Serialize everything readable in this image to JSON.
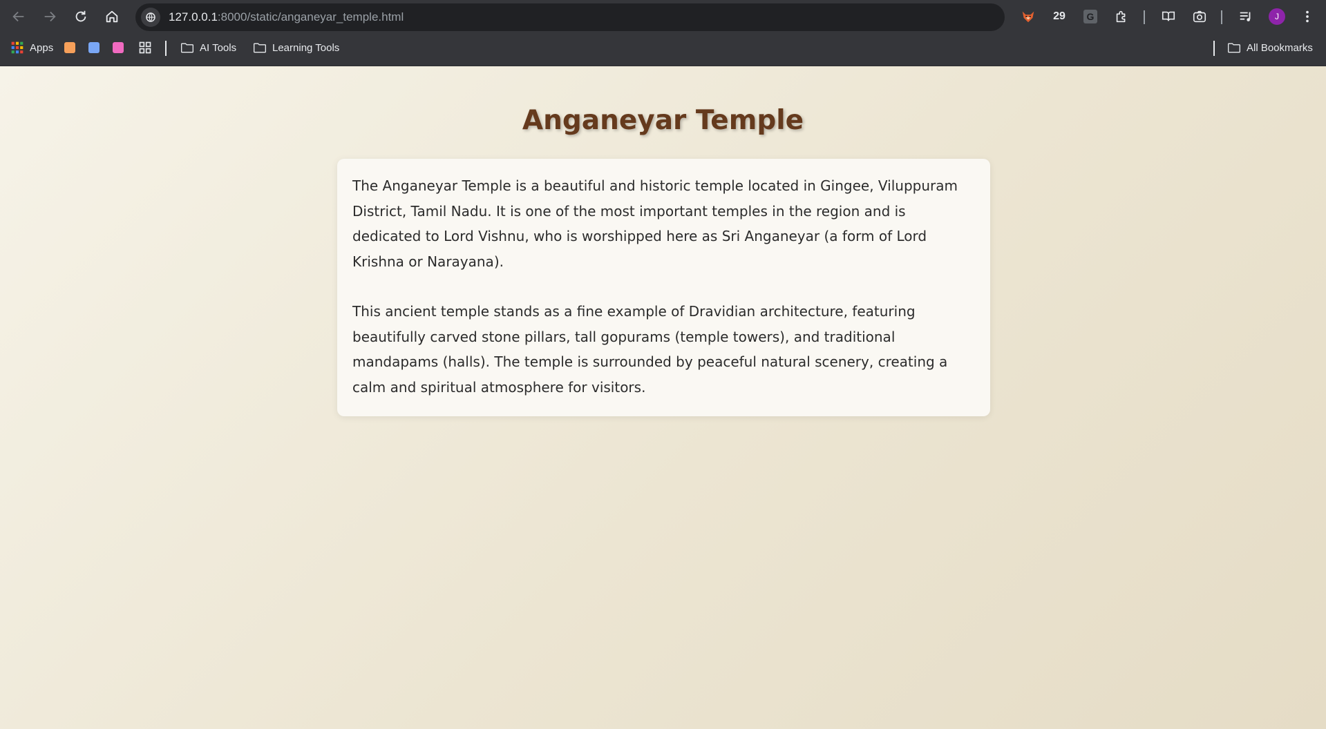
{
  "browser": {
    "url_host": "127.0.0.1",
    "url_path": ":8000/static/anganeyar_temple.html",
    "extension_counter": "29",
    "extension_letter": "G",
    "profile_initial": "J"
  },
  "bookmarks": {
    "apps_label": "Apps",
    "items": [
      {
        "label": "AI Tools"
      },
      {
        "label": "Learning Tools"
      }
    ],
    "all_bookmarks_label": "All Bookmarks"
  },
  "page": {
    "title": "Anganeyar Temple",
    "paragraphs": [
      "The Anganeyar Temple is a beautiful and historic temple located in Gingee, Viluppuram District, Tamil Nadu. It is one of the most important temples in the region and is dedicated to Lord Vishnu, who is worshipped here as Sri Anganeyar (a form of Lord Krishna or Narayana).",
      "This ancient temple stands as a fine example of Dravidian architecture, featuring beautifully carved stone pillars, tall gopurams (temple towers), and traditional mandapams (halls). The temple is surrounded by peaceful natural scenery, creating a calm and spiritual atmosphere for visitors."
    ]
  },
  "colors": {
    "title": "#653a1d",
    "page_background": "#ece6d3",
    "card_background": "#faf8f3",
    "chrome": "#35363a"
  }
}
